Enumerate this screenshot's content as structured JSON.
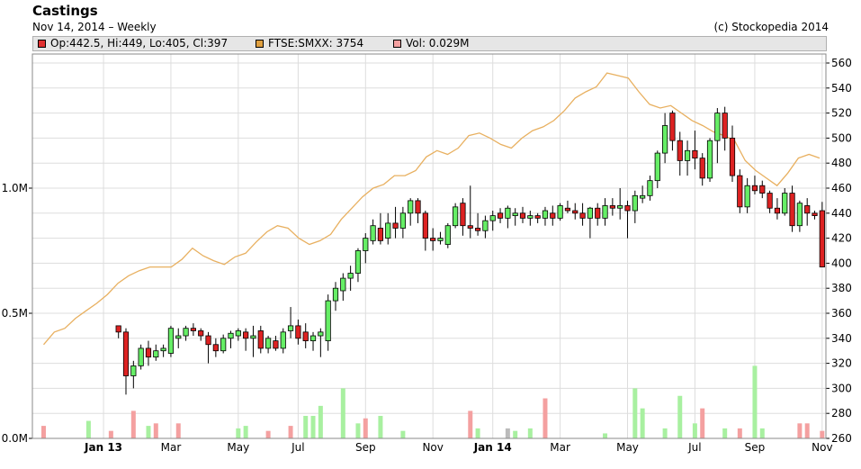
{
  "header": {
    "title": "Castings",
    "subtitle": "Nov 14, 2014 – Weekly",
    "copyright": "(c) Stockopedia 2014"
  },
  "legend": [
    {
      "label": "Op:442.5, Hi:449, Lo:405, Cl:397",
      "color": "#e03030"
    },
    {
      "label": "FTSE:SMXX: 3754",
      "color": "#e0a040"
    },
    {
      "label": "Vol: 0.029M",
      "color": "#f4a0a0"
    }
  ],
  "colors": {
    "up": "#66ee66",
    "down": "#dd2222",
    "line": "#e8b060",
    "vol_up": "#a8f0a0",
    "vol_down": "#f4a0a0",
    "vol_flat": "#bbbbbb",
    "grid": "#dddddd"
  },
  "chart_data": {
    "type": "candlestick",
    "interval": "weekly",
    "price_axis": {
      "min": 260,
      "max": 560,
      "ticks": [
        260,
        280,
        300,
        320,
        340,
        360,
        380,
        400,
        420,
        440,
        460,
        480,
        500,
        520,
        540,
        560
      ],
      "position": "right"
    },
    "volume_axis": {
      "min": 0,
      "max": 1.5,
      "ticks": [
        {
          "v": 0,
          "label": "0.0M"
        },
        {
          "v": 0.5,
          "label": "0.5M"
        },
        {
          "v": 1.0,
          "label": "1.0M"
        }
      ],
      "position": "left"
    },
    "x_ticks": [
      {
        "label": "Jan 13",
        "week": 9,
        "bold": true
      },
      {
        "label": "Mar",
        "week": 18,
        "bold": false
      },
      {
        "label": "May",
        "week": 27,
        "bold": false
      },
      {
        "label": "Jul",
        "week": 35,
        "bold": false
      },
      {
        "label": "Sep",
        "week": 44,
        "bold": false
      },
      {
        "label": "Nov",
        "week": 53,
        "bold": false
      },
      {
        "label": "Jan 14",
        "week": 61,
        "bold": true
      },
      {
        "label": "Mar",
        "week": 70,
        "bold": false
      },
      {
        "label": "May",
        "week": 79,
        "bold": false
      },
      {
        "label": "Jul",
        "week": 88,
        "bold": false
      },
      {
        "label": "Sep",
        "week": 96,
        "bold": false
      },
      {
        "label": "Nov",
        "week": 105,
        "bold": false
      }
    ],
    "series": [
      {
        "name": "Castings",
        "ohlc": [
          [
            350,
            350,
            340,
            345
          ],
          [
            345,
            348,
            295,
            310
          ],
          [
            310,
            322,
            300,
            318
          ],
          [
            318,
            335,
            315,
            332
          ],
          [
            332,
            338,
            318,
            325
          ],
          [
            325,
            335,
            322,
            330
          ],
          [
            330,
            335,
            325,
            332
          ],
          [
            328,
            350,
            325,
            348
          ],
          [
            340,
            348,
            332,
            342
          ],
          [
            342,
            350,
            338,
            348
          ],
          [
            348,
            352,
            342,
            346
          ],
          [
            346,
            348,
            338,
            342
          ],
          [
            342,
            345,
            320,
            335
          ],
          [
            335,
            340,
            325,
            330
          ],
          [
            330,
            343,
            328,
            340
          ],
          [
            340,
            346,
            332,
            344
          ],
          [
            342,
            348,
            338,
            346
          ],
          [
            345,
            348,
            330,
            340
          ],
          [
            340,
            350,
            325,
            342
          ],
          [
            346,
            350,
            328,
            332
          ],
          [
            332,
            342,
            328,
            340
          ],
          [
            338,
            342,
            330,
            332
          ],
          [
            332,
            348,
            328,
            345
          ],
          [
            346,
            365,
            340,
            350
          ],
          [
            350,
            355,
            335,
            340
          ],
          [
            345,
            352,
            332,
            338
          ],
          [
            338,
            345,
            330,
            342
          ],
          [
            342,
            348,
            325,
            345
          ],
          [
            338,
            375,
            330,
            370
          ],
          [
            370,
            385,
            362,
            380
          ],
          [
            378,
            392,
            370,
            388
          ],
          [
            388,
            398,
            378,
            392
          ],
          [
            392,
            412,
            385,
            410
          ],
          [
            410,
            424,
            400,
            420
          ],
          [
            418,
            435,
            415,
            430
          ],
          [
            428,
            440,
            415,
            418
          ],
          [
            420,
            440,
            415,
            432
          ],
          [
            432,
            445,
            420,
            428
          ],
          [
            428,
            445,
            420,
            440
          ],
          [
            440,
            452,
            430,
            450
          ],
          [
            450,
            452,
            432,
            440
          ],
          [
            440,
            442,
            410,
            420
          ],
          [
            420,
            428,
            410,
            418
          ],
          [
            418,
            425,
            415,
            420
          ],
          [
            415,
            432,
            412,
            430
          ],
          [
            430,
            448,
            428,
            445
          ],
          [
            448,
            452,
            422,
            430
          ],
          [
            430,
            462,
            420,
            428
          ],
          [
            428,
            440,
            422,
            426
          ],
          [
            426,
            438,
            420,
            434
          ],
          [
            434,
            442,
            426,
            438
          ],
          [
            440,
            444,
            432,
            436
          ],
          [
            436,
            446,
            428,
            444
          ],
          [
            438,
            444,
            430,
            440
          ],
          [
            440,
            445,
            432,
            436
          ],
          [
            436,
            442,
            430,
            438
          ],
          [
            438,
            440,
            432,
            436
          ],
          [
            436,
            445,
            430,
            442
          ],
          [
            440,
            446,
            430,
            436
          ],
          [
            436,
            448,
            434,
            446
          ],
          [
            444,
            450,
            440,
            442
          ],
          [
            442,
            448,
            435,
            440
          ],
          [
            440,
            448,
            430,
            436
          ],
          [
            436,
            445,
            420,
            444
          ],
          [
            444,
            448,
            430,
            436
          ],
          [
            436,
            452,
            430,
            446
          ],
          [
            446,
            452,
            438,
            444
          ],
          [
            444,
            460,
            435,
            446
          ],
          [
            446,
            450,
            420,
            442
          ],
          [
            442,
            458,
            432,
            454
          ],
          [
            452,
            462,
            448,
            454
          ],
          [
            454,
            470,
            450,
            466
          ],
          [
            466,
            490,
            460,
            488
          ],
          [
            488,
            520,
            480,
            510
          ],
          [
            520,
            522,
            490,
            498
          ],
          [
            498,
            505,
            470,
            482
          ],
          [
            482,
            498,
            470,
            490
          ],
          [
            490,
            506,
            475,
            484
          ],
          [
            484,
            488,
            462,
            468
          ],
          [
            468,
            500,
            465,
            498
          ],
          [
            498,
            524,
            480,
            520
          ],
          [
            520,
            525,
            490,
            500
          ],
          [
            500,
            510,
            465,
            470
          ],
          [
            470,
            475,
            440,
            445
          ],
          [
            445,
            468,
            440,
            462
          ],
          [
            462,
            470,
            455,
            458
          ],
          [
            462,
            466,
            452,
            456
          ],
          [
            456,
            458,
            440,
            444
          ],
          [
            444,
            452,
            435,
            440
          ],
          [
            440,
            460,
            438,
            456
          ],
          [
            456,
            462,
            425,
            430
          ],
          [
            430,
            450,
            425,
            448
          ],
          [
            446,
            452,
            430,
            440
          ],
          [
            440,
            442,
            435,
            438
          ],
          [
            442,
            449,
            405,
            397
          ]
        ],
        "closes_start_week": 10
      },
      {
        "name": "FTSE:SMXX",
        "values": [
          335,
          345,
          348,
          356,
          362,
          368,
          375,
          384,
          390,
          394,
          397,
          397,
          397,
          403,
          412,
          406,
          402,
          399,
          405,
          408,
          417,
          425,
          430,
          428,
          420,
          415,
          418,
          423,
          435,
          444,
          453,
          460,
          463,
          470,
          470,
          474,
          485,
          490,
          487,
          492,
          502,
          504,
          500,
          495,
          492,
          500,
          506,
          509,
          514,
          522,
          532,
          537,
          541,
          552,
          550,
          548,
          537,
          527,
          524,
          526,
          520,
          514,
          510,
          505,
          502,
          498,
          482,
          474,
          468,
          462,
          472,
          484,
          487,
          484
        ],
        "values_start_week": 1,
        "values_step_weeks": 1.42
      },
      {
        "name": "Vol",
        "values": [
          0.03,
          0.02,
          0.04,
          0.03,
          0.02,
          0.02,
          0.05,
          0.04,
          0.07,
          0.06,
          0.03,
          0.02,
          0.12,
          0.05,
          0.02,
          0.07,
          0.06,
          0.03,
          0.04,
          0.02,
          0.05,
          0.03,
          0.02,
          0.03,
          0.02,
          0.02,
          0.05,
          0.04,
          0.03,
          0.03,
          0.06,
          0.05,
          0.04,
          0.06,
          0.04,
          0.04,
          0.03,
          0.02,
          0.03,
          0.2,
          0.23,
          0.22,
          0.06,
          0.25,
          0.09,
          0.08,
          0.04,
          0.03,
          0.02,
          0.03,
          0.04,
          0.03,
          0.02,
          0.02,
          0.03,
          0.05,
          0.08,
          0.04,
          0.05,
          0.03,
          0.02,
          0.03,
          0.02,
          0.05,
          0.02,
          0.04,
          0.02,
          0.03,
          0.02,
          0.03,
          0.02,
          0.02,
          0.11,
          0.04,
          0.02,
          0.02,
          0.03,
          0.02,
          0.02,
          0.03,
          0.06,
          0.05,
          0.02,
          0.03,
          0.03,
          0.02,
          0.02,
          0.03,
          0.02,
          0.03,
          0.04,
          0.02,
          0.02,
          0.03,
          0.02,
          0.02,
          0.03,
          0.02,
          0.02,
          0.03,
          0.02,
          0.03,
          0.01,
          0.01,
          0.01
        ],
        "highlights": [
          {
            "week": 1,
            "v": 0.05,
            "dir": "down"
          },
          {
            "week": 7,
            "v": 0.07,
            "dir": "up"
          },
          {
            "week": 10,
            "v": 0.03,
            "dir": "down"
          },
          {
            "week": 13,
            "v": 0.11,
            "dir": "down"
          },
          {
            "week": 15,
            "v": 0.05,
            "dir": "up"
          },
          {
            "week": 16,
            "v": 0.06,
            "dir": "down"
          },
          {
            "week": 19,
            "v": 0.06,
            "dir": "down"
          },
          {
            "week": 27,
            "v": 0.04,
            "dir": "up"
          },
          {
            "week": 28,
            "v": 0.05,
            "dir": "up"
          },
          {
            "week": 31,
            "v": 0.03,
            "dir": "down"
          },
          {
            "week": 34,
            "v": 0.05,
            "dir": "down"
          },
          {
            "week": 36,
            "v": 0.09,
            "dir": "up"
          },
          {
            "week": 37,
            "v": 0.09,
            "dir": "up"
          },
          {
            "week": 38,
            "v": 0.13,
            "dir": "up"
          },
          {
            "week": 41,
            "v": 0.2,
            "dir": "up"
          },
          {
            "week": 43,
            "v": 0.06,
            "dir": "up"
          },
          {
            "week": 44,
            "v": 0.08,
            "dir": "down"
          },
          {
            "week": 46,
            "v": 0.09,
            "dir": "up"
          },
          {
            "week": 49,
            "v": 0.03,
            "dir": "up"
          },
          {
            "week": 58,
            "v": 0.11,
            "dir": "down"
          },
          {
            "week": 59,
            "v": 0.04,
            "dir": "up"
          },
          {
            "week": 63,
            "v": 0.04,
            "dir": "flat"
          },
          {
            "week": 64,
            "v": 0.03,
            "dir": "up"
          },
          {
            "week": 66,
            "v": 0.04,
            "dir": "up"
          },
          {
            "week": 68,
            "v": 0.16,
            "dir": "down"
          },
          {
            "week": 76,
            "v": 0.02,
            "dir": "up"
          },
          {
            "week": 80,
            "v": 0.2,
            "dir": "up"
          },
          {
            "week": 81,
            "v": 0.12,
            "dir": "up"
          },
          {
            "week": 84,
            "v": 0.04,
            "dir": "up"
          },
          {
            "week": 86,
            "v": 0.17,
            "dir": "up"
          },
          {
            "week": 88,
            "v": 0.06,
            "dir": "up"
          },
          {
            "week": 89,
            "v": 0.12,
            "dir": "down"
          },
          {
            "week": 92,
            "v": 0.04,
            "dir": "up"
          },
          {
            "week": 94,
            "v": 0.04,
            "dir": "down"
          },
          {
            "week": 96,
            "v": 0.29,
            "dir": "up"
          },
          {
            "week": 97,
            "v": 0.04,
            "dir": "up"
          },
          {
            "week": 102,
            "v": 0.06,
            "dir": "down"
          },
          {
            "week": 103,
            "v": 0.06,
            "dir": "down"
          },
          {
            "week": 105,
            "v": 0.03,
            "dir": "down"
          }
        ]
      }
    ],
    "grid": true,
    "legend_position": "top"
  }
}
